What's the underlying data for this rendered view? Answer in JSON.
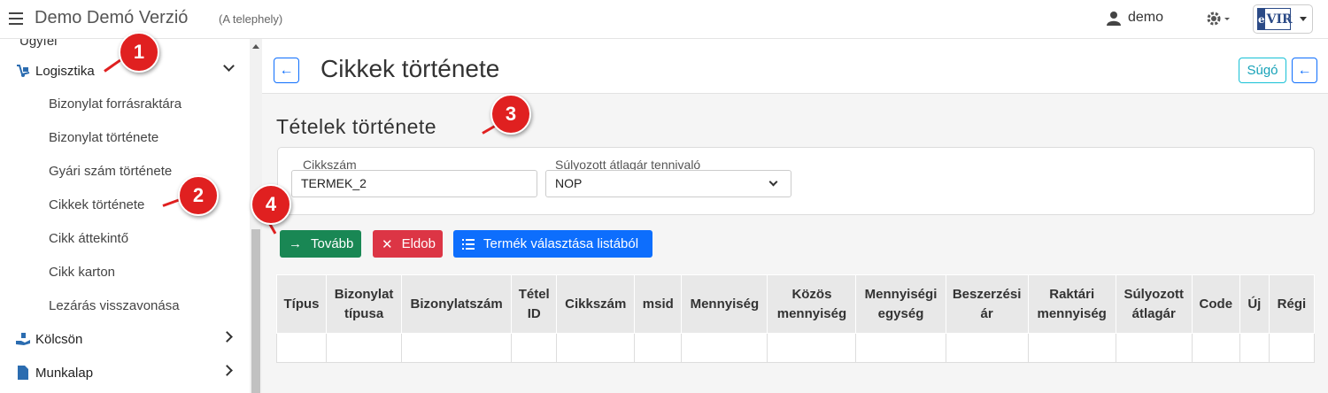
{
  "topbar": {
    "app_title": "Demo Demó Verzió",
    "app_subtitle": "(A telephely)",
    "user_name": "demo",
    "logo_text": "VIR",
    "logo_letter": "e"
  },
  "sidebar": {
    "partial_item": "Ügyfél",
    "logistics": {
      "label": "Logisztika"
    },
    "logistics_items": [
      "Bizonylat forrásraktára",
      "Bizonylat története",
      "Gyári szám története",
      "Cikkek története",
      "Cikk áttekintő",
      "Cikk karton",
      "Lezárás visszavonása"
    ],
    "loan": {
      "label": "Kölcsön"
    },
    "worksheet": {
      "label": "Munkalap"
    }
  },
  "page": {
    "title": "Cikkek története",
    "help_label": "Súgó",
    "section_title": "Tételek története"
  },
  "filters": {
    "item_number": {
      "label": "Cikkszám",
      "value": "TERMEK_2"
    },
    "weighted_avg": {
      "label": "Súlyozott átlagár tennivaló",
      "value": "NOP"
    }
  },
  "buttons": {
    "next": "Tovább",
    "discard": "Eldob",
    "choose_product": "Termék választása listából"
  },
  "table": {
    "headers": [
      "Típus",
      "Bizonylat típusa",
      "Bizonylatszám",
      "Tétel ID",
      "Cikkszám",
      "msid",
      "Mennyiség",
      "Közös mennyiség",
      "Mennyiségi egység",
      "Beszerzési ár",
      "Raktári mennyiség",
      "Súlyozott átlagár",
      "Code",
      "Új",
      "Régi"
    ]
  },
  "annotations": [
    "1",
    "2",
    "3",
    "4"
  ],
  "colors": {
    "primary": "#0d6efd",
    "success": "#198754",
    "danger": "#dc3545",
    "info": "#17a2b8",
    "annotation": "#e02020"
  }
}
